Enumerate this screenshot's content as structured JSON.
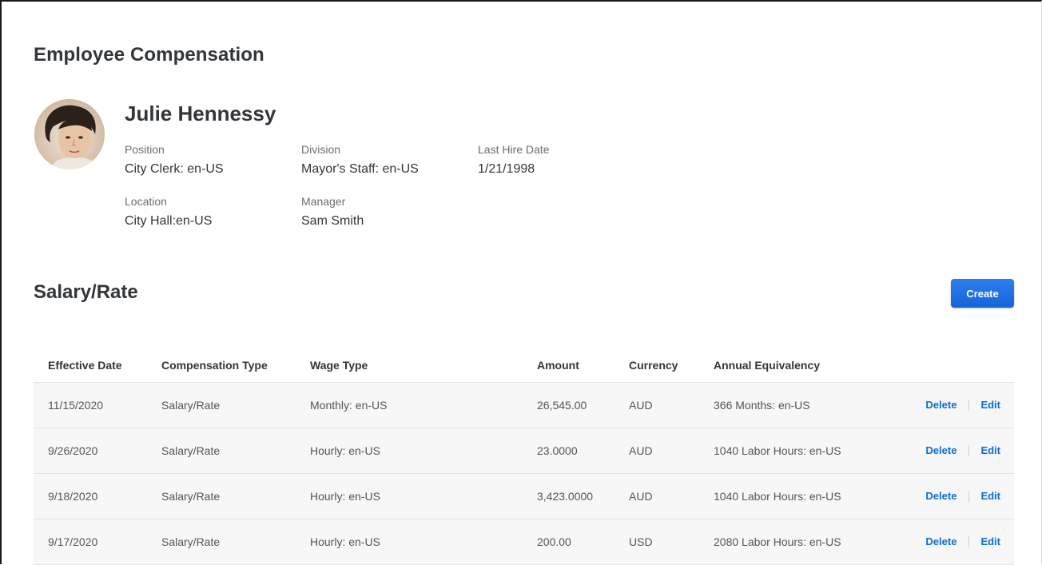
{
  "page": {
    "title": "Employee Compensation"
  },
  "employee": {
    "name": "Julie Hennessy",
    "fields": {
      "position": {
        "label": "Position",
        "value": "City Clerk: en-US"
      },
      "division": {
        "label": "Division",
        "value": "Mayor's Staff: en-US"
      },
      "last_hire_date": {
        "label": "Last Hire Date",
        "value": "1/21/1998"
      },
      "location": {
        "label": "Location",
        "value": "City Hall:en-US"
      },
      "manager": {
        "label": "Manager",
        "value": "Sam Smith"
      }
    }
  },
  "salary": {
    "title": "Salary/Rate",
    "create_label": "Create",
    "columns": {
      "effective_date": "Effective Date",
      "compensation_type": "Compensation Type",
      "wage_type": "Wage Type",
      "amount": "Amount",
      "currency": "Currency",
      "annual_equivalency": "Annual Equivalency"
    },
    "delete_label": "Delete",
    "edit_label": "Edit",
    "rows": [
      {
        "effective_date": "11/15/2020",
        "compensation_type": "Salary/Rate",
        "wage_type": "Monthly: en-US",
        "amount": "26,545.00",
        "currency": "AUD",
        "annual_equivalency": "366 Months: en-US"
      },
      {
        "effective_date": "9/26/2020",
        "compensation_type": "Salary/Rate",
        "wage_type": "Hourly: en-US",
        "amount": "23.0000",
        "currency": "AUD",
        "annual_equivalency": "1040 Labor Hours: en-US"
      },
      {
        "effective_date": "9/18/2020",
        "compensation_type": "Salary/Rate",
        "wage_type": "Hourly: en-US",
        "amount": "3,423.0000",
        "currency": "AUD",
        "annual_equivalency": "1040 Labor Hours: en-US"
      },
      {
        "effective_date": "9/17/2020",
        "compensation_type": "Salary/Rate",
        "wage_type": "Hourly: en-US",
        "amount": "200.00",
        "currency": "USD",
        "annual_equivalency": "2080 Labor Hours: en-US"
      }
    ]
  },
  "colors": {
    "accent": "#0a6ed1",
    "button": "#1a73e8",
    "heading": "#32363a",
    "row_bg": "#f7f7f7"
  }
}
